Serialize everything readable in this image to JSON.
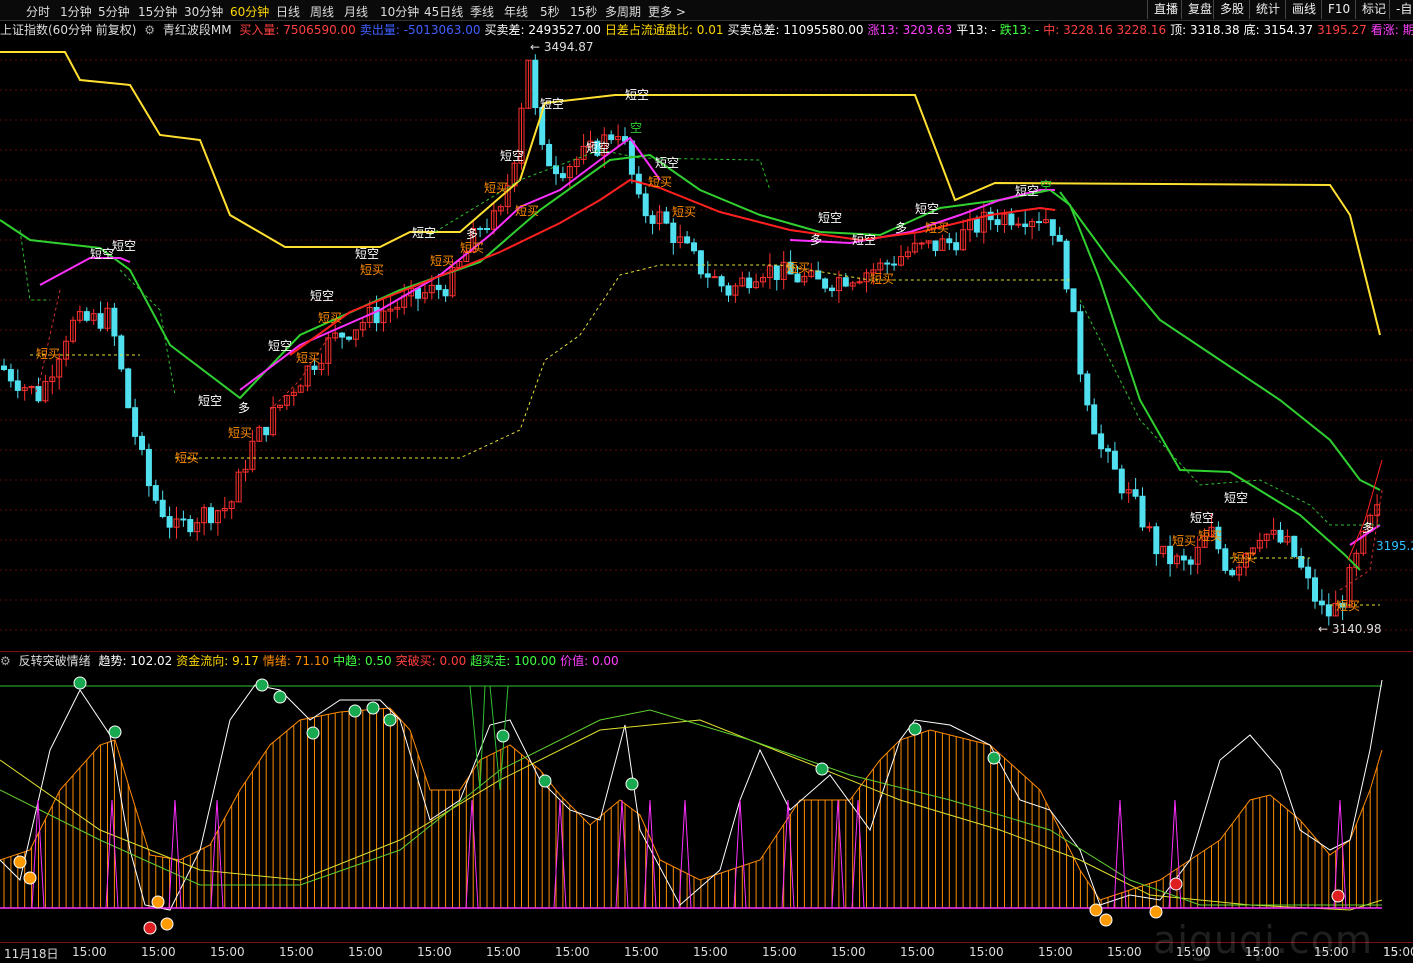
{
  "toolbar": {
    "timeframes": [
      "分时",
      "1分钟",
      "5分钟",
      "15分钟",
      "30分钟",
      "60分钟",
      "日线",
      "周线",
      "月线",
      "10分钟",
      "45日线",
      "季线",
      "年线",
      "5秒",
      "15秒",
      "多周期",
      "更多 >"
    ],
    "active_timeframe": "60分钟",
    "right_buttons": [
      "直播",
      "复盘",
      "多股",
      "统计",
      "画线",
      "F10",
      "标记",
      "-自"
    ]
  },
  "main_info": {
    "symbol": "上证指数(60分钟 前复权)",
    "indicator_name": "青红波段MM",
    "items": [
      {
        "label": "买入量",
        "value": "7506590.00",
        "color": "#ff4040"
      },
      {
        "label": "卖出量",
        "value": "-5013063.00",
        "color": "#4060ff"
      },
      {
        "label": "买卖差",
        "value": "2493527.00",
        "color": "#ffffff"
      },
      {
        "label": "日差占流通盘比",
        "value": "0.01",
        "color": "#ffd800"
      },
      {
        "label": "买卖总差",
        "value": "11095580.00",
        "color": "#ffffff"
      },
      {
        "label": "涨13",
        "value": "3203.63",
        "color": "#ff40ff"
      },
      {
        "label": "平13",
        "value": "-",
        "color": "#ffffff"
      },
      {
        "label": "跌13",
        "value": "-",
        "color": "#40ff40"
      },
      {
        "label": "中",
        "value": "3228.16  3228.16",
        "color": "#ff4040"
      },
      {
        "label": "顶",
        "value": "3318.38",
        "color": "#ffffff"
      },
      {
        "label": "底",
        "value": "3154.37",
        "color": "#ffffff"
      },
      {
        "label": "",
        "value": "3195.27",
        "color": "#ff4040"
      },
      {
        "label": "看涨",
        "value": "期多增仓",
        "color": "#ff40ff"
      }
    ]
  },
  "price_labels": {
    "high": "3494.87",
    "low": "3140.98",
    "current": "3195.2"
  },
  "signals": {
    "short_empty": "短空",
    "short_buy": "短买",
    "long": "多",
    "empty": "空"
  },
  "indicator_info": {
    "name": "反转突破情绪",
    "items": [
      {
        "label": "趋势",
        "value": "102.02",
        "color": "#ffffff"
      },
      {
        "label": "资金流向",
        "value": "9.17",
        "color": "#ffd800"
      },
      {
        "label": "情绪",
        "value": "71.10",
        "color": "#ff8c00"
      },
      {
        "label": "中趋",
        "value": "0.50",
        "color": "#40ff40"
      },
      {
        "label": "突破买",
        "value": "0.00",
        "color": "#ff4040"
      },
      {
        "label": "超买走",
        "value": "100.00",
        "color": "#40ff40"
      },
      {
        "label": "价值",
        "value": "0.00",
        "color": "#ff40ff"
      }
    ]
  },
  "axis": {
    "first_label": "11月18日",
    "tick_label": "15:00",
    "tick_count": 20,
    "last_label": "15"
  },
  "colors": {
    "up": "#ff3030",
    "down": "#50e0f0",
    "ma_yellow": "#ffe030",
    "ma_green": "#30d030",
    "ma_magenta": "#ff30ff",
    "ma_red": "#ff2020"
  },
  "watermark": "aiguqi.com"
}
